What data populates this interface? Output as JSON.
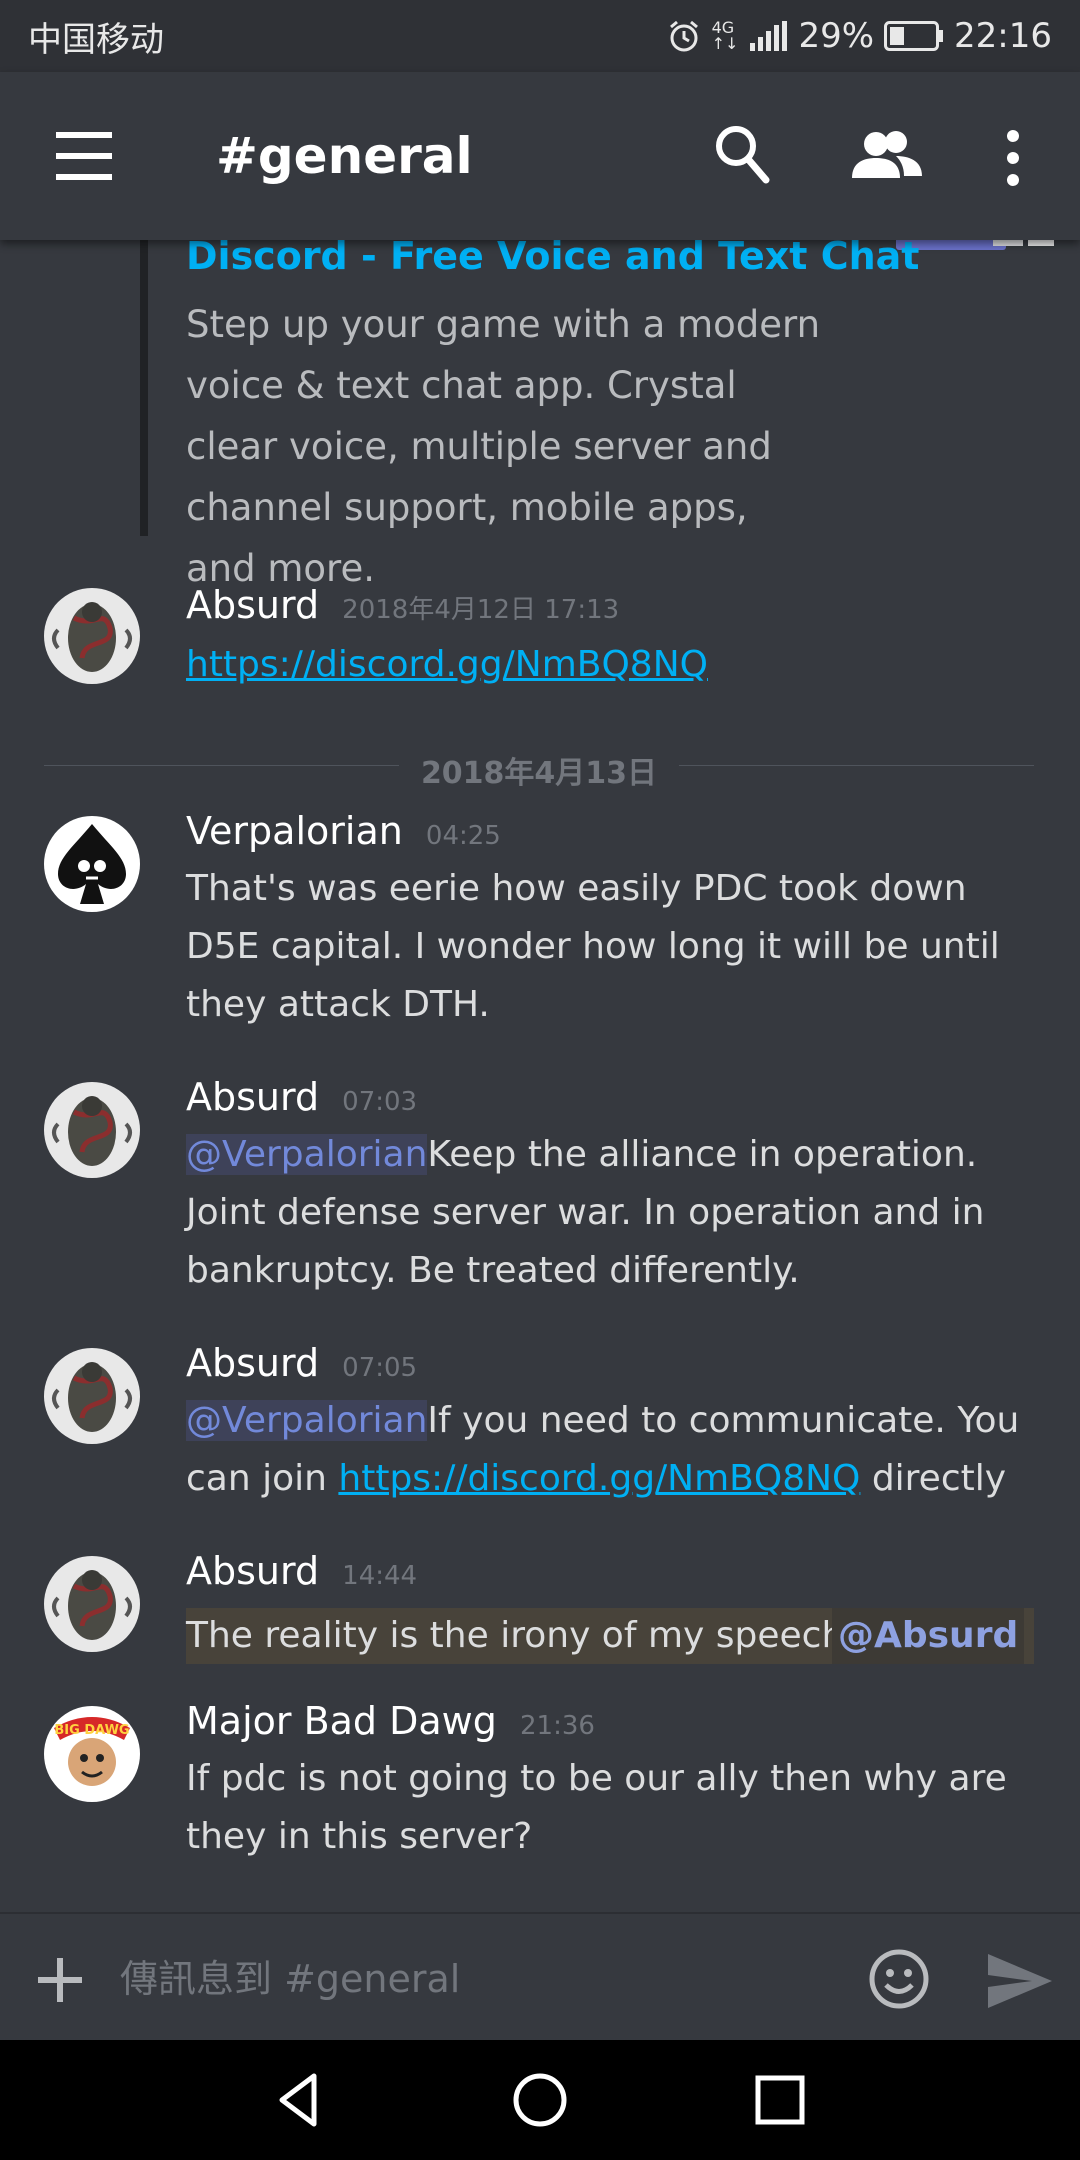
{
  "status_bar": {
    "carrier": "中国移动",
    "network_type_top": "4G",
    "network_type_bottom": "↑↓",
    "battery_percent": "29%",
    "time": "22:16"
  },
  "header": {
    "channel_title": "#general",
    "icons": [
      "menu-icon",
      "search-icon",
      "members-icon",
      "more-vert-icon"
    ]
  },
  "embed": {
    "title": "Discord - Free Voice and Text Chat",
    "description": "Step up your game with a modern voice & text chat app. Crystal clear voice, multiple server and channel support, mobile apps, and more."
  },
  "messages": [
    {
      "author": "Absurd",
      "timestamp": "2018年4月12日 17:13",
      "link": "https://discord.gg/NmBQ8NQ"
    },
    {
      "author": "Verpalorian",
      "timestamp": "04:25",
      "text": "That's was eerie how easily PDC took down D5E capital. I wonder how long it will be until they attack DTH."
    },
    {
      "author": "Absurd",
      "timestamp": "07:03",
      "mention": "@Verpalorian",
      "text": "Keep the alliance in operation. Joint defense server war. In operation and in bankruptcy. Be treated differently."
    },
    {
      "author": "Absurd",
      "timestamp": "07:05",
      "mention": "@Verpalorian",
      "text_before": "If you need to communicate. You can join ",
      "link": "https://discord.gg/NmBQ8NQ",
      "text_after": " directly"
    },
    {
      "author": "Absurd",
      "timestamp": "14:44",
      "text": "The reality is the irony of my speech.",
      "mention": "@Absurd"
    },
    {
      "author": "Major Bad Dawg",
      "timestamp": "21:36",
      "text": "If pdc is not going to be our ally then why are they in this server?"
    }
  ],
  "date_divider": "2018年4月13日",
  "composer": {
    "placeholder": "傳訊息到 #general",
    "icons": [
      "add-icon",
      "emoji-icon",
      "send-icon"
    ]
  },
  "nav": {
    "icons": [
      "back-icon",
      "home-icon",
      "recents-icon"
    ]
  },
  "colors": {
    "background": "#36393f",
    "link": "#00b0f4",
    "mention": "#7289da",
    "author": "#ffffff",
    "timestamp": "#72767d"
  },
  "avatar_badge_text": "BIG DAWG"
}
